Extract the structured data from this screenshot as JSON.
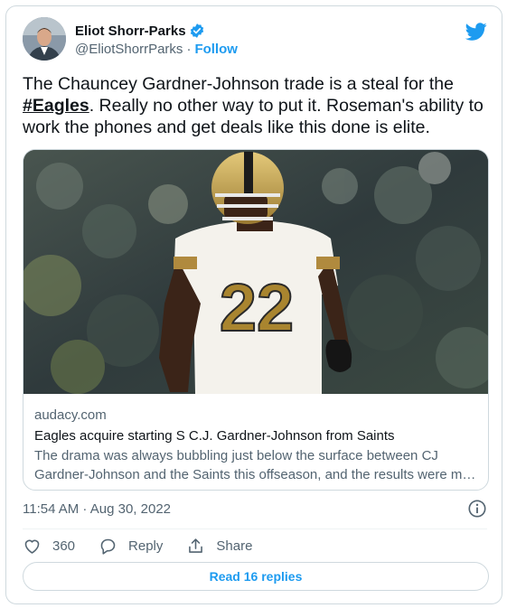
{
  "author": {
    "name": "Eliot Shorr-Parks",
    "handle": "@EliotShorrParks",
    "separator": "·",
    "follow_label": "Follow"
  },
  "tweet": {
    "text_before": "The Chauncey Gardner-Johnson trade is a steal for the ",
    "hashtag": "#Eagles",
    "text_after": ". Really no other way to put it. Roseman's ability to work the phones and get deals like this done is elite."
  },
  "link_card": {
    "domain": "audacy.com",
    "title": "Eagles acquire starting S C.J. Gardner-Johnson from Saints",
    "description_line1": "The drama was always bubbling just below the surface between CJ",
    "description_line2": "Gardner-Johnson and the Saints this offseason, and the results were ma...",
    "image_jersey_number": "22"
  },
  "meta": {
    "timestamp": "11:54 AM · Aug 30, 2022"
  },
  "actions": {
    "like_count": "360",
    "reply_label": "Reply",
    "share_label": "Share"
  },
  "read_replies_label": "Read 16 replies",
  "colors": {
    "accent": "#1d9bf0",
    "text": "#0f1419",
    "secondary": "#536471",
    "border": "#cfd9de"
  },
  "icons": [
    "verified-badge-icon",
    "twitter-bird-icon",
    "info-icon",
    "heart-icon",
    "reply-icon",
    "share-icon"
  ]
}
